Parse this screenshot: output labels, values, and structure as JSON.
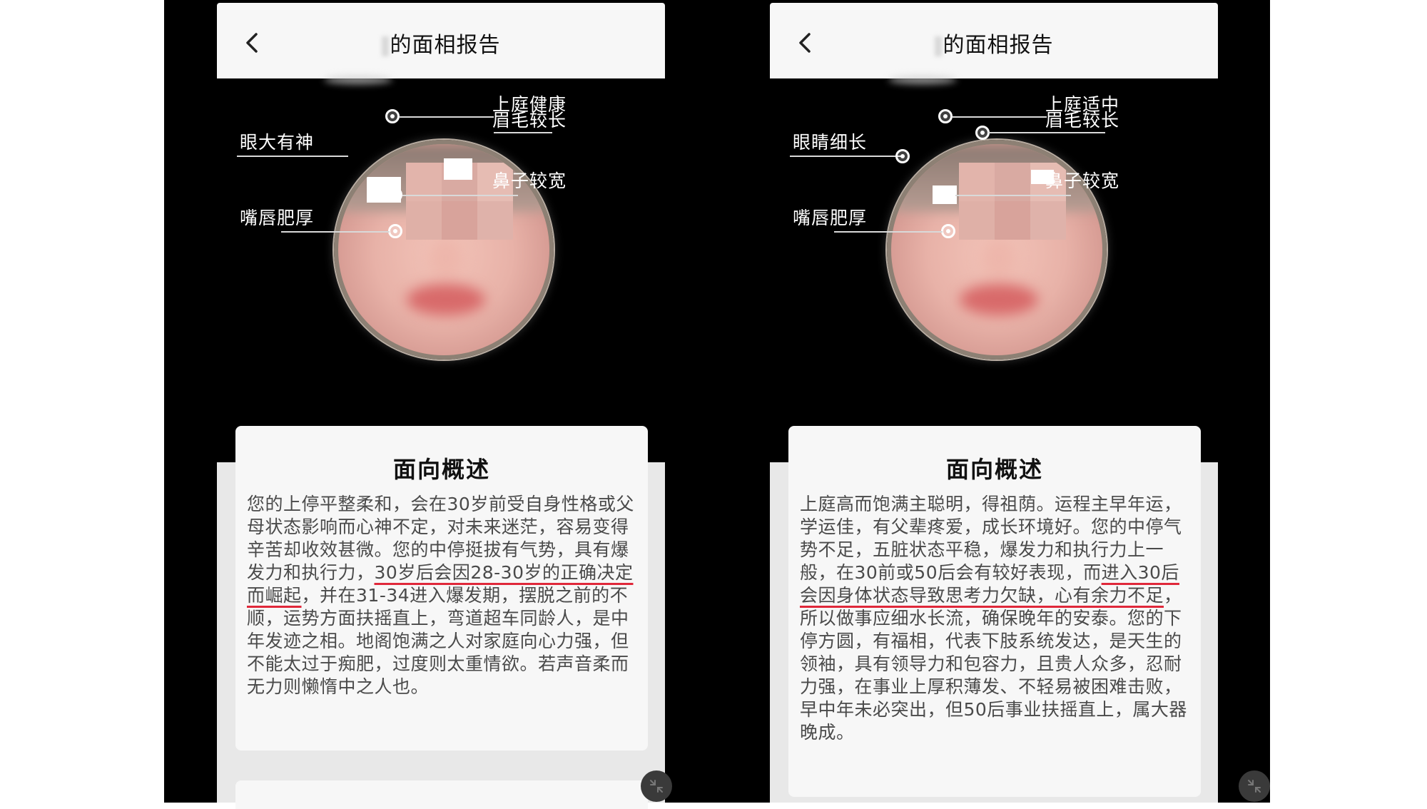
{
  "panels": [
    {
      "header": {
        "title": "的面相报告"
      },
      "labels": {
        "top_right_1": "上庭健康",
        "top_right_2": "眉毛较长",
        "left_upper": "眼大有神",
        "right_middle": "鼻子较宽",
        "left_lower": "嘴唇肥厚"
      },
      "card": {
        "title": "面向概述",
        "text_a": "您的上停平整柔和，会在30岁前受自身性格或父母状态影响而心神不定，对未来迷茫，容易变得辛苦却收效甚微。您的中停挺拔有气势，具有爆发力和执行力，",
        "text_underlined": "30岁后会因28-30岁的正确决定而崛起",
        "text_b": "，并在31-34进入爆发期，摆脱之前的不顺，运势方面扶摇直上，弯道超车同龄人，是中年发迹之相。地阁饱满之人对家庭向心力强，但不能太过于痴肥，过度则太重情欲。若声音柔而无力则懒惰中之人也。"
      }
    },
    {
      "header": {
        "title": "的面相报告"
      },
      "labels": {
        "top_right_1": "上庭适中",
        "top_right_2": "眉毛较长",
        "left_upper": "眼睛细长",
        "right_middle": "鼻子较宽",
        "left_lower": "嘴唇肥厚"
      },
      "card": {
        "title": "面向概述",
        "text_a": "上庭高而饱满主聪明，得祖荫。运程主早年运，学运佳，有父辈疼爱，成长环境好。您的中停气势不足，五脏状态平稳，爆发力和执行力上一般，在30前或50后会有较好表现，而",
        "text_underlined": "进入30后会因身体状态导致思考力欠缺，心有余力不足",
        "text_b": "，所以做事应细水长流，确保晚年的安泰。您的下停方圆，有福相，代表下肢系统发达，是天生的领袖，具有领导力和包容力，且贵人众多，忍耐力强，在事业上厚积薄发、不轻易被困难击败，早中年未必突出，但50后事业扶摇直上，属大器晚成。"
      }
    }
  ],
  "icons": {
    "back": "chevron-left-icon",
    "collapse": "collapse-arrows-icon"
  },
  "colors": {
    "underline": "#e0283a",
    "background": "#000000",
    "card": "#f7f7f7"
  }
}
